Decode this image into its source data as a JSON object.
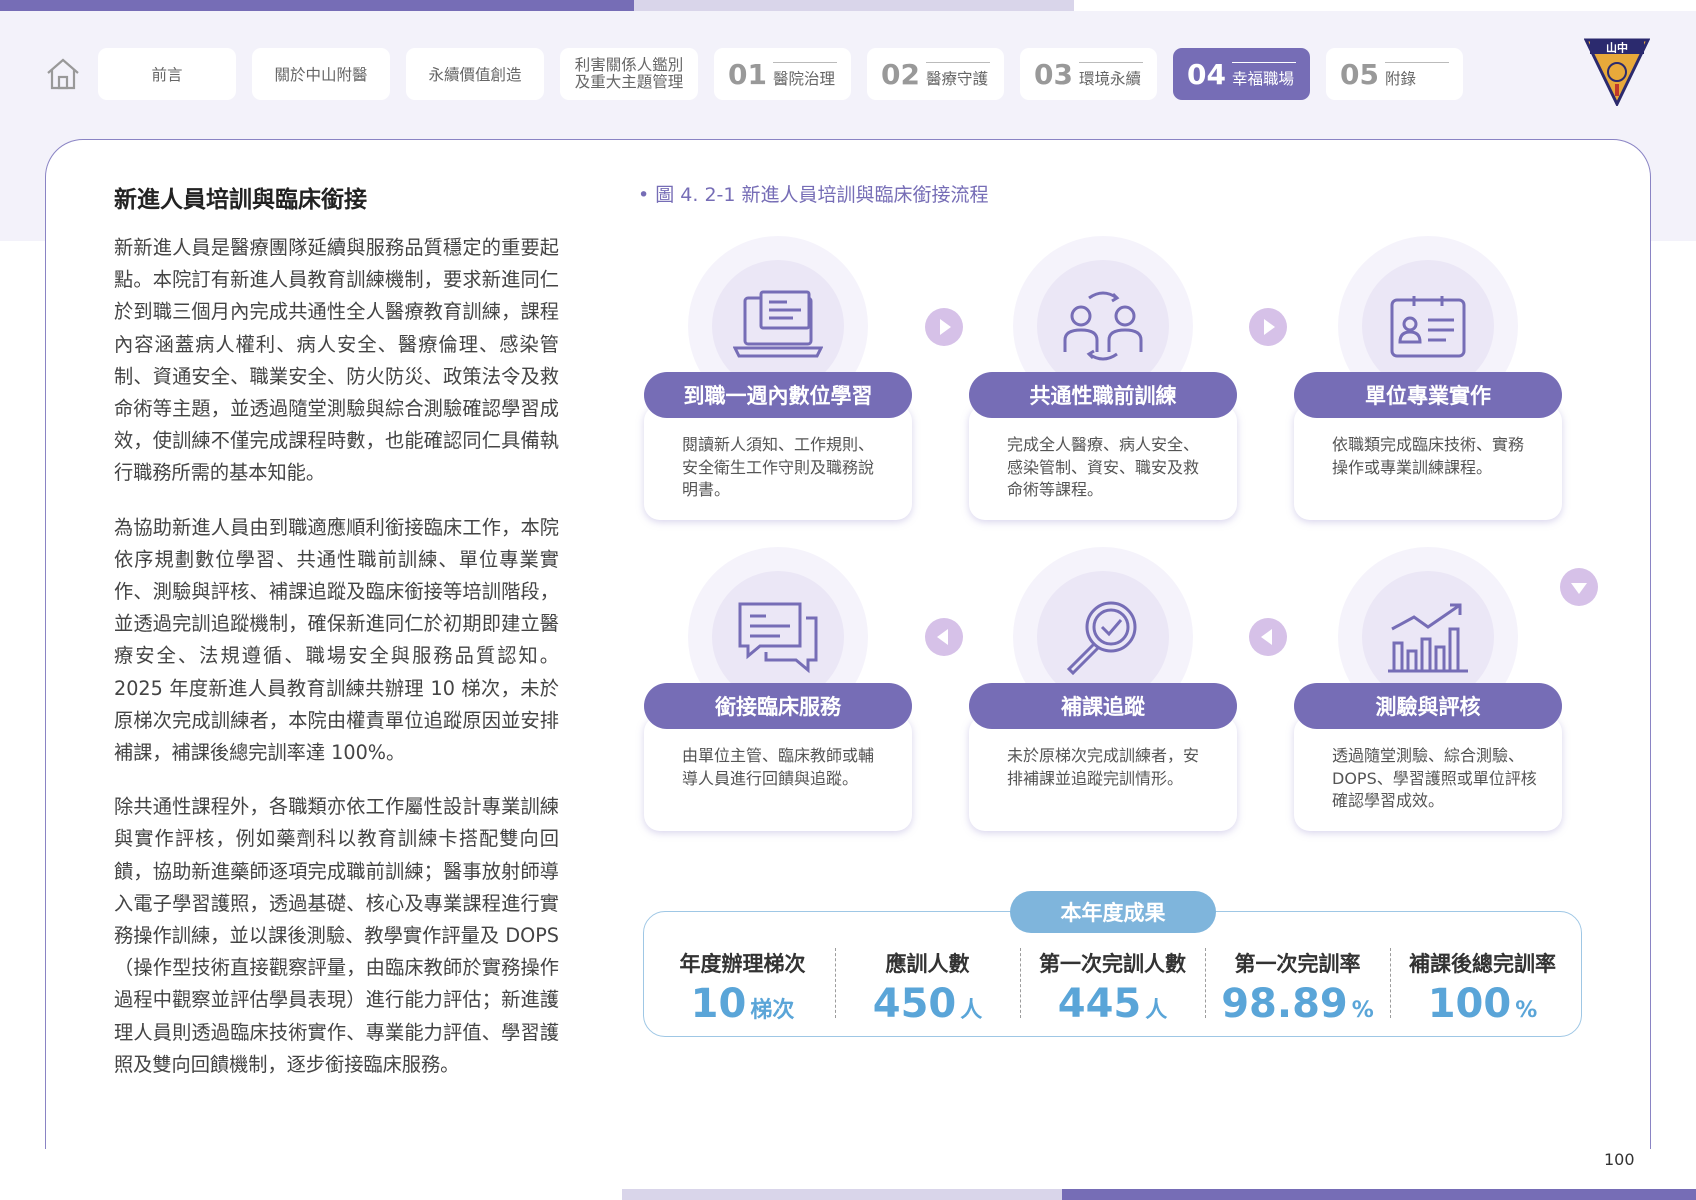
{
  "nav": {
    "items": [
      {
        "label": "前言"
      },
      {
        "label": "關於中山附醫"
      },
      {
        "label": "永續價值創造"
      },
      {
        "label": "利害關係人鑑別\n及重大主題管理"
      },
      {
        "num": "01",
        "label": "醫院治理"
      },
      {
        "num": "02",
        "label": "醫療守護"
      },
      {
        "num": "03",
        "label": "環境永續"
      },
      {
        "num": "04",
        "label": "幸福職場"
      },
      {
        "num": "05",
        "label": "附錄"
      }
    ]
  },
  "logo": {
    "text": "山中"
  },
  "section": {
    "title": "新進人員培訓與臨床銜接",
    "paragraphs": [
      "新新進人員是醫療團隊延續與服務品質穩定的重要起點。本院訂有新進人員教育訓練機制，要求新進同仁於到職三個月內完成共通性全人醫療教育訓練，課程內容涵蓋病人權利、病人安全、醫療倫理、感染管制、資通安全、職業安全、防火防災、政策法令及救命術等主題，並透過隨堂測驗與綜合測驗確認學習成效，使訓練不僅完成課程時數，也能確認同仁具備執行職務所需的基本知能。",
      "為協助新進人員由到職適應順利銜接臨床工作，本院依序規劃數位學習、共通性職前訓練、單位專業實作、測驗與評核、補課追蹤及臨床銜接等培訓階段，並透過完訓追蹤機制，確保新進同仁於初期即建立醫療安全、法規遵循、職場安全與服務品質認知。2025 年度新進人員教育訓練共辦理 10 梯次，未於原梯次完成訓練者，本院由權責單位追蹤原因並安排補課，補課後總完訓率達 100%。",
      "除共通性課程外，各職類亦依工作屬性設計專業訓練與實作評核，例如藥劑科以教育訓練卡搭配雙向回饋，協助新進藥師逐項完成職前訓練；醫事放射師導入電子學習護照，透過基礎、核心及專業課程進行實務操作訓練，並以課後測驗、教學實作評量及 DOPS（操作型技術直接觀察評量，由臨床教師於實務操作過程中觀察並評估學員表現）進行能力評估；新進護理人員則透過臨床技術實作、專業能力評值、學習護照及雙向回饋機制，逐步銜接臨床服務。"
    ]
  },
  "figure": {
    "title": "• 圖 4. 2-1 新進人員培訓與臨床銜接流程",
    "steps": [
      {
        "label": "到職一週內數位學習",
        "desc": "閱讀新人須知、工作規則、安全衛生工作守則及職務說明書。",
        "icon": "laptop-icon"
      },
      {
        "label": "共通性職前訓練",
        "desc": "完成全人醫療、病人安全、感染管制、資安、職安及救命術等課程。",
        "icon": "people-exchange-icon"
      },
      {
        "label": "單位專業實作",
        "desc": "依職類完成臨床技術、實務操作或專業訓練課程。",
        "icon": "id-badge-icon"
      },
      {
        "label": "測驗與評核",
        "desc": "透過隨堂測驗、綜合測驗、DOPS、學習護照或單位評核確認學習成效。",
        "icon": "bar-chart-icon"
      },
      {
        "label": "補課追蹤",
        "desc": "未於原梯次完成訓練者，安排補課並追蹤完訓情形。",
        "icon": "magnifier-check-icon"
      },
      {
        "label": "銜接臨床服務",
        "desc": "由單位主管、臨床教師或輔導人員進行回饋與追蹤。",
        "icon": "chat-bubbles-icon"
      }
    ]
  },
  "results": {
    "tag": "本年度成果",
    "stats": [
      {
        "label": "年度辦理梯次",
        "value": "10",
        "unit": "梯次"
      },
      {
        "label": "應訓人數",
        "value": "450",
        "unit": "人"
      },
      {
        "label": "第一次完訓人數",
        "value": "445",
        "unit": "人"
      },
      {
        "label": "第一次完訓率",
        "value": "98.89",
        "unit": "%"
      },
      {
        "label": "補課後總完訓率",
        "value": "100",
        "unit": "%"
      }
    ]
  },
  "page_number": "100",
  "colors": {
    "primary": "#766db6",
    "accent_blue": "#5aa5d8",
    "arrow": "#d6c1e8"
  }
}
